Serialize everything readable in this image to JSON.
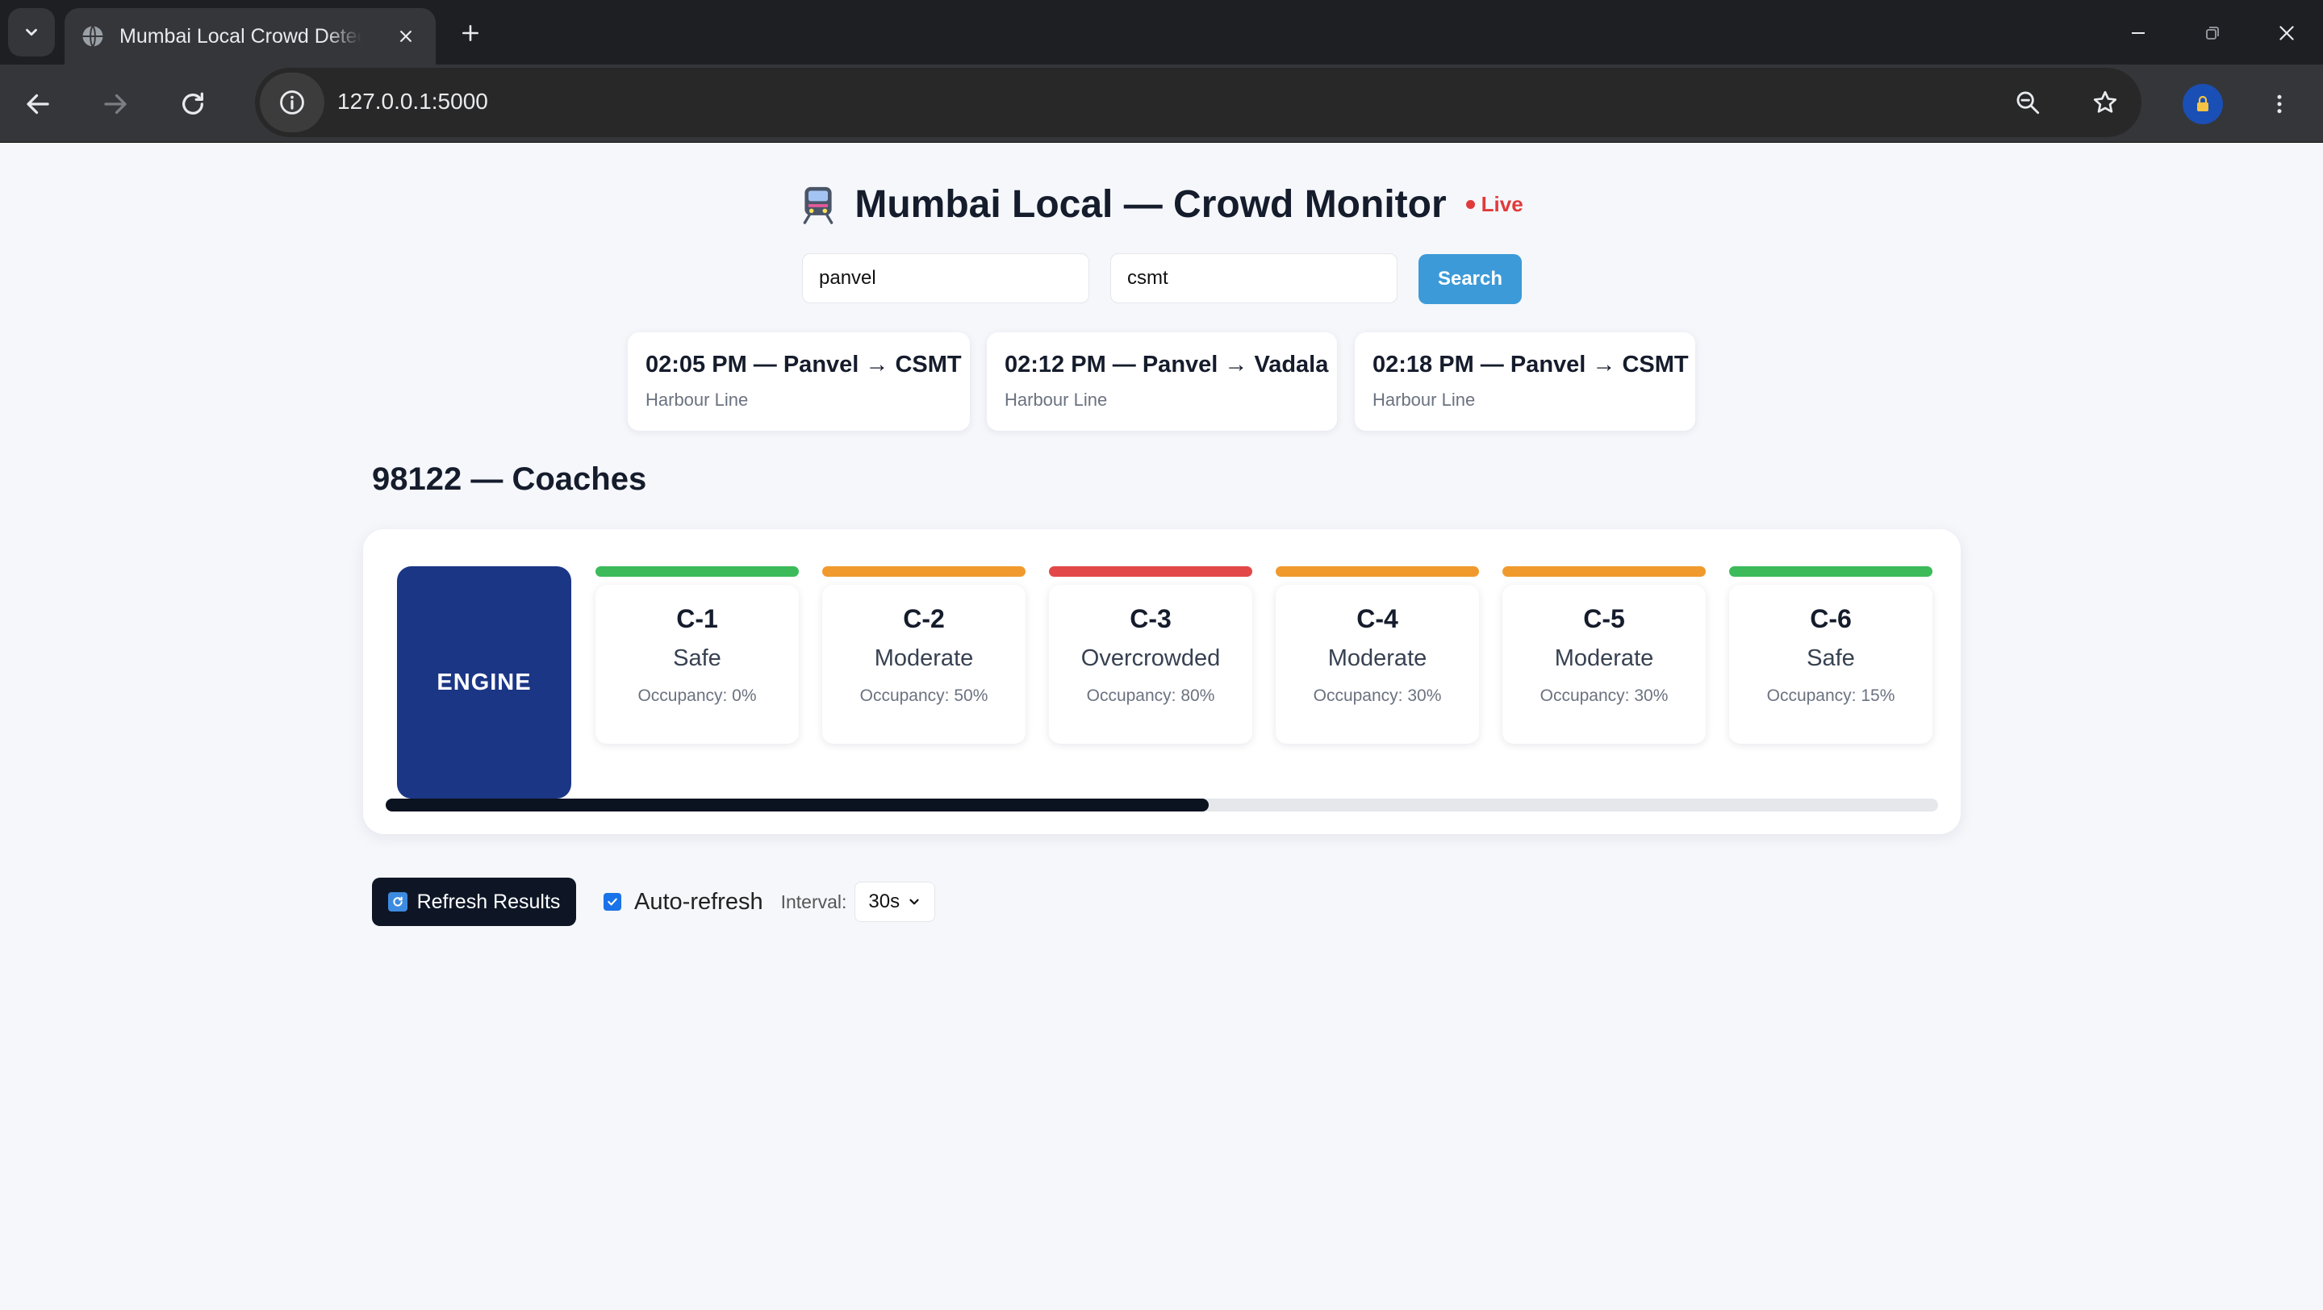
{
  "browser": {
    "tab_title": "Mumbai Local Crowd Detection",
    "url": "127.0.0.1:5000"
  },
  "header": {
    "title": "Mumbai Local — Crowd Monitor",
    "live_label": "Live"
  },
  "search": {
    "from_value": "panvel",
    "to_value": "csmt",
    "button_label": "Search"
  },
  "trains": [
    {
      "title": "02:05 PM — Panvel → CSMT",
      "line": "Harbour Line"
    },
    {
      "title": "02:12 PM — Panvel → Vadala",
      "line": "Harbour Line"
    },
    {
      "title": "02:18 PM — Panvel → CSMT",
      "line": "Harbour Line"
    }
  ],
  "coaches_section": {
    "title": "98122 — Coaches",
    "engine_label": "ENGINE",
    "scroll_fraction": 0.53
  },
  "coaches": [
    {
      "name": "C-1",
      "status": "Safe",
      "occupancy": "Occupancy: 0%",
      "color": "#3dbb5a"
    },
    {
      "name": "C-2",
      "status": "Moderate",
      "occupancy": "Occupancy: 50%",
      "color": "#f09a2e"
    },
    {
      "name": "C-3",
      "status": "Overcrowded",
      "occupancy": "Occupancy: 80%",
      "color": "#e24848"
    },
    {
      "name": "C-4",
      "status": "Moderate",
      "occupancy": "Occupancy: 30%",
      "color": "#f09a2e"
    },
    {
      "name": "C-5",
      "status": "Moderate",
      "occupancy": "Occupancy: 30%",
      "color": "#f09a2e"
    },
    {
      "name": "C-6",
      "status": "Safe",
      "occupancy": "Occupancy: 15%",
      "color": "#3dbb5a"
    }
  ],
  "controls": {
    "refresh_label": "Refresh Results",
    "auto_refresh_label": "Auto-refresh",
    "auto_refresh_checked": true,
    "interval_label": "Interval:",
    "interval_value": "30s"
  }
}
